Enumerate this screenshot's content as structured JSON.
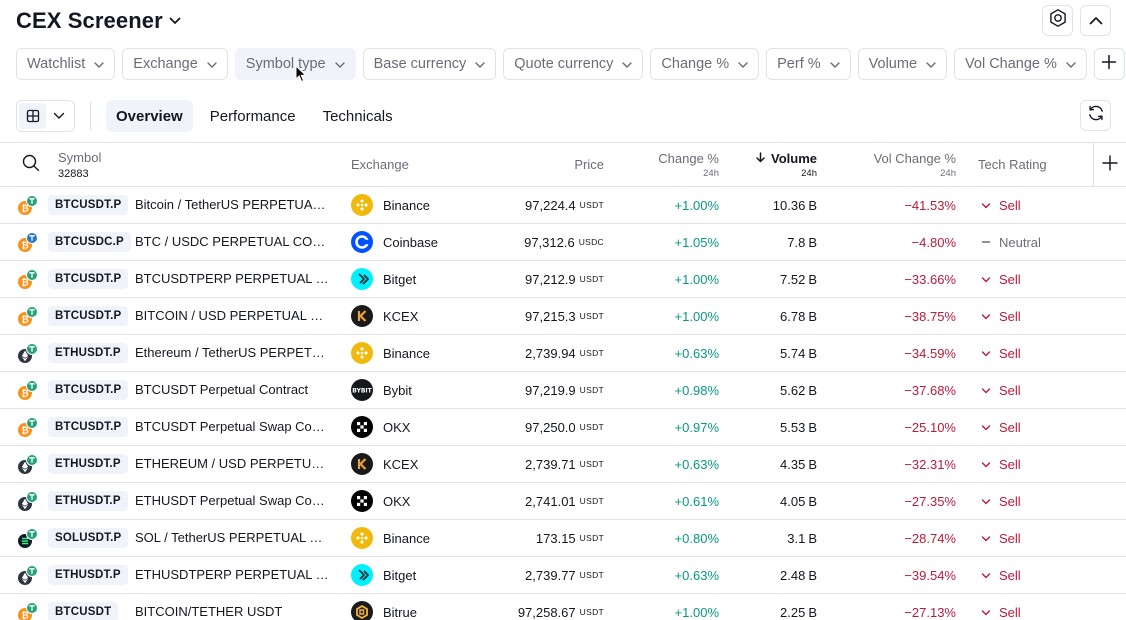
{
  "header": {
    "title": "CEX Screener"
  },
  "filters": [
    {
      "label": "Watchlist"
    },
    {
      "label": "Exchange"
    },
    {
      "label": "Symbol type"
    },
    {
      "label": "Base currency"
    },
    {
      "label": "Quote currency"
    },
    {
      "label": "Change %"
    },
    {
      "label": "Perf %"
    },
    {
      "label": "Volume"
    },
    {
      "label": "Vol Change %"
    }
  ],
  "tabs": [
    {
      "label": "Overview",
      "active": true
    },
    {
      "label": "Performance",
      "active": false
    },
    {
      "label": "Technicals",
      "active": false
    }
  ],
  "columns": {
    "symbol": "Symbol",
    "symbol_count": "32883",
    "exchange": "Exchange",
    "price": "Price",
    "change": "Change %",
    "change_sub": "24h",
    "volume": "Volume",
    "volume_sub": "24h",
    "vol_change": "Vol Change %",
    "vol_change_sub": "24h",
    "tech_rating": "Tech Rating"
  },
  "colors": {
    "positive": "#089981",
    "negative": "#b71c3b",
    "neutral": "#6a6d78",
    "binance": "#f0b90b",
    "coinbase": "#0052ff",
    "bitget": "#00f0ff",
    "kcex": "#1a1a1a",
    "bybit": "#17181e",
    "okx": "#000000",
    "bitrue": "#1b1b1b"
  },
  "rows": [
    {
      "ticker": "BTCUSDT.P",
      "description": "Bitcoin / TetherUS PERPETUAL CONTRACT",
      "base": "btc",
      "quote": "usdt",
      "exchange": "Binance",
      "exchange_icon": "binance-logo-icon",
      "price": "97,224.4",
      "price_unit": "USDT",
      "change": "+1.00%",
      "volume": "10.36",
      "volume_unit": "B",
      "vol_change": "−41.53%",
      "rating": "Sell",
      "rating_kind": "sell"
    },
    {
      "ticker": "BTCUSDC.P",
      "description": "BTC / USDC PERPETUAL CONTRACT",
      "base": "btc",
      "quote": "usdc",
      "exchange": "Coinbase",
      "exchange_icon": "coinbase-logo-icon",
      "price": "97,312.6",
      "price_unit": "USDC",
      "change": "+1.05%",
      "volume": "7.8",
      "volume_unit": "B",
      "vol_change": "−4.80%",
      "rating": "Neutral",
      "rating_kind": "neutral"
    },
    {
      "ticker": "BTCUSDT.P",
      "description": "BTCUSDTPERP PERPETUAL MIX CONTRACT",
      "base": "btc",
      "quote": "usdt",
      "exchange": "Bitget",
      "exchange_icon": "bitget-logo-icon",
      "price": "97,212.9",
      "price_unit": "USDT",
      "change": "+1.00%",
      "volume": "7.52",
      "volume_unit": "B",
      "vol_change": "−33.66%",
      "rating": "Sell",
      "rating_kind": "sell"
    },
    {
      "ticker": "BTCUSDT.P",
      "description": "BITCOIN / USD PERPETUAL SWAP CONTRACT",
      "base": "btc",
      "quote": "usdt",
      "exchange": "KCEX",
      "exchange_icon": "kcex-logo-icon",
      "price": "97,215.3",
      "price_unit": "USDT",
      "change": "+1.00%",
      "volume": "6.78",
      "volume_unit": "B",
      "vol_change": "−38.75%",
      "rating": "Sell",
      "rating_kind": "sell"
    },
    {
      "ticker": "ETHUSDT.P",
      "description": "Ethereum / TetherUS PERPETUAL CONTRACT",
      "base": "eth",
      "quote": "usdt",
      "exchange": "Binance",
      "exchange_icon": "binance-logo-icon",
      "price": "2,739.94",
      "price_unit": "USDT",
      "change": "+0.63%",
      "volume": "5.74",
      "volume_unit": "B",
      "vol_change": "−34.59%",
      "rating": "Sell",
      "rating_kind": "sell"
    },
    {
      "ticker": "BTCUSDT.P",
      "description": "BTCUSDT Perpetual Contract",
      "base": "btc",
      "quote": "usdt",
      "exchange": "Bybit",
      "exchange_icon": "bybit-logo-icon",
      "price": "97,219.9",
      "price_unit": "USDT",
      "change": "+0.98%",
      "volume": "5.62",
      "volume_unit": "B",
      "vol_change": "−37.68%",
      "rating": "Sell",
      "rating_kind": "sell"
    },
    {
      "ticker": "BTCUSDT.P",
      "description": "BTCUSDT Perpetual Swap Contract",
      "base": "btc",
      "quote": "usdt",
      "exchange": "OKX",
      "exchange_icon": "okx-logo-icon",
      "price": "97,250.0",
      "price_unit": "USDT",
      "change": "+0.97%",
      "volume": "5.53",
      "volume_unit": "B",
      "vol_change": "−25.10%",
      "rating": "Sell",
      "rating_kind": "sell"
    },
    {
      "ticker": "ETHUSDT.P",
      "description": "ETHEREUM / USD PERPETUAL SWAP CONTRACT",
      "base": "eth",
      "quote": "usdt",
      "exchange": "KCEX",
      "exchange_icon": "kcex-logo-icon",
      "price": "2,739.71",
      "price_unit": "USDT",
      "change": "+0.63%",
      "volume": "4.35",
      "volume_unit": "B",
      "vol_change": "−32.31%",
      "rating": "Sell",
      "rating_kind": "sell"
    },
    {
      "ticker": "ETHUSDT.P",
      "description": "ETHUSDT Perpetual Swap Contract",
      "base": "eth",
      "quote": "usdt",
      "exchange": "OKX",
      "exchange_icon": "okx-logo-icon",
      "price": "2,741.01",
      "price_unit": "USDT",
      "change": "+0.61%",
      "volume": "4.05",
      "volume_unit": "B",
      "vol_change": "−27.35%",
      "rating": "Sell",
      "rating_kind": "sell"
    },
    {
      "ticker": "SOLUSDT.P",
      "description": "SOL / TetherUS PERPETUAL CONTRACT",
      "base": "sol",
      "quote": "usdt",
      "exchange": "Binance",
      "exchange_icon": "binance-logo-icon",
      "price": "173.15",
      "price_unit": "USDT",
      "change": "+0.80%",
      "volume": "3.1",
      "volume_unit": "B",
      "vol_change": "−28.74%",
      "rating": "Sell",
      "rating_kind": "sell"
    },
    {
      "ticker": "ETHUSDT.P",
      "description": "ETHUSDTPERP PERPETUAL MIX CONTRACT",
      "base": "eth",
      "quote": "usdt",
      "exchange": "Bitget",
      "exchange_icon": "bitget-logo-icon",
      "price": "2,739.77",
      "price_unit": "USDT",
      "change": "+0.63%",
      "volume": "2.48",
      "volume_unit": "B",
      "vol_change": "−39.54%",
      "rating": "Sell",
      "rating_kind": "sell"
    },
    {
      "ticker": "BTCUSDT",
      "description": "BITCOIN/TETHER USDT",
      "base": "btc",
      "quote": "usdt",
      "exchange": "Bitrue",
      "exchange_icon": "bitrue-logo-icon",
      "price": "97,258.67",
      "price_unit": "USDT",
      "change": "+1.00%",
      "volume": "2.25",
      "volume_unit": "B",
      "vol_change": "−27.13%",
      "rating": "Sell",
      "rating_kind": "sell"
    }
  ]
}
